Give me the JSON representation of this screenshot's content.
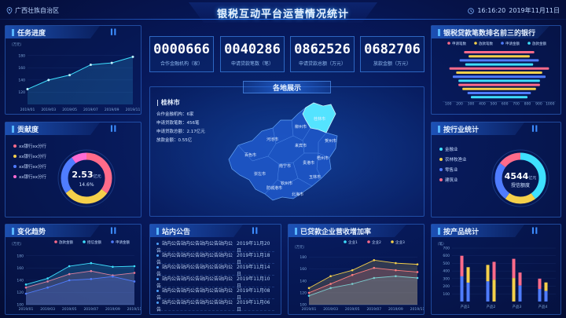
{
  "header": {
    "title": "银税互动平台运营情况统计",
    "region": "广西壮族自治区",
    "time": "16:16:20",
    "date": "2019年11月11日"
  },
  "colors": {
    "accent": "#2f7cff",
    "cyan": "#3ee0ff",
    "pink": "#ff6b8a",
    "yellow": "#f5d04a",
    "blue": "#4f7cff",
    "green": "#5fe0a0"
  },
  "counters": [
    {
      "value": "0000666",
      "label": "合作金融机构（家）"
    },
    {
      "value": "0040286",
      "label": "申请贷款笔数（笔）"
    },
    {
      "value": "0862526",
      "label": "申请贷款总额（万元）"
    },
    {
      "value": "0682706",
      "label": "放款金额（万元）"
    }
  ],
  "panels": {
    "progress": "任务进度",
    "contribution": "贡献度",
    "trend": "变化趋势",
    "map": "各地展示",
    "notice": "站内公告",
    "growth": "已贷款企业营收增加率",
    "top3": "银税贷款笔数排名前三的银行",
    "industry": "按行业统计",
    "product": "按产品统计"
  },
  "progress_chart": {
    "unit": "（万元）",
    "y_ticks": [
      "180",
      "160",
      "140",
      "120"
    ],
    "x_ticks": [
      "2019/01",
      "2019/03",
      "2019/05",
      "2019/07",
      "2019/09",
      "2019/11"
    ]
  },
  "contribution": {
    "legend": [
      "xx银行xx分行",
      "xx银行xx分行",
      "xx银行xx分行",
      "xx银行xx分行"
    ],
    "value": "2.53",
    "unit": "亿元",
    "percent": "14.6%"
  },
  "trend_chart": {
    "unit": "（万元）",
    "legend": [
      "放款金额",
      "授信金额",
      "申请金额"
    ],
    "y_ticks": [
      "180",
      "160",
      "140",
      "120",
      "100"
    ],
    "x_ticks": [
      "2019/01",
      "2019/03",
      "2019/05",
      "2019/07",
      "2019/09",
      "2019/11"
    ]
  },
  "map": {
    "selected_city": "桂林市",
    "info": [
      "合作金融机构：6家",
      "申请贷款笔数：456笔",
      "申请贷款总额：2.17亿元",
      "放款金额：0.55亿"
    ],
    "cities": [
      "桂林市",
      "柳州市",
      "河池市",
      "来宾市",
      "百色市",
      "贺州市",
      "梧州市",
      "南宁市",
      "贵港市",
      "崇左市",
      "玉林市",
      "防城港市",
      "钦州市",
      "北海市"
    ]
  },
  "notices": [
    {
      "text": "站内公告站内公告站内公告站内公告",
      "date": "2019年11月20日"
    },
    {
      "text": "站内公告站内公告站内公告站内公告",
      "date": "2019年11月18日"
    },
    {
      "text": "站内公告站内公告站内公告站内公告",
      "date": "2019年11月14日"
    },
    {
      "text": "站内公告站内公告站内公告站内公告",
      "date": "2019年11月10日"
    },
    {
      "text": "站内公告站内公告站内公告站内公告",
      "date": "2019年11月08日"
    },
    {
      "text": "站内公告站内公告站内公告站内公告",
      "date": "2019年11月06日"
    }
  ],
  "growth_chart": {
    "unit": "（万元）",
    "legend": [
      "企业1",
      "企业2",
      "企业3"
    ],
    "y_ticks": [
      "180",
      "160",
      "140",
      "120",
      "100"
    ],
    "x_ticks": [
      "2019/01",
      "2019/03",
      "2019/05",
      "2019/07",
      "2019/09",
      "2019/11"
    ]
  },
  "top3_chart": {
    "legend": [
      "申请笔数",
      "放款笔数",
      "申请金额",
      "放款金额"
    ],
    "x_ticks": [
      "100",
      "200",
      "300",
      "400",
      "500",
      "600",
      "700",
      "800",
      "900",
      "1000"
    ]
  },
  "industry": {
    "legend": [
      "金融业",
      "农林牧渔业",
      "零售业",
      "建筑业"
    ],
    "value": "4544",
    "unit": "亿元",
    "label": "授信额度"
  },
  "product_chart": {
    "unit": "（笔）",
    "y_ticks": [
      "700",
      "600",
      "500",
      "400",
      "300",
      "200",
      "100"
    ],
    "x_ticks": [
      "产品1",
      "产品2",
      "产品3",
      "产品4"
    ]
  },
  "chart_data": [
    {
      "type": "line",
      "title": "任务进度",
      "x": [
        "2019/01",
        "2019/03",
        "2019/05",
        "2019/07",
        "2019/09",
        "2019/11"
      ],
      "values": [
        125,
        140,
        148,
        165,
        168,
        178
      ],
      "ylabel": "（万元）",
      "ylim": [
        100,
        190
      ]
    },
    {
      "type": "pie",
      "title": "贡献度",
      "labels": [
        "xx银行xx分行",
        "xx银行xx分行",
        "xx银行xx分行",
        "xx银行xx分行"
      ],
      "values": [
        35,
        30,
        25,
        10
      ]
    },
    {
      "type": "line",
      "title": "变化趋势",
      "x": [
        "2019/01",
        "2019/03",
        "2019/05",
        "2019/07",
        "2019/09",
        "2019/11"
      ],
      "series": [
        {
          "name": "放款金额",
          "values": [
            128,
            138,
            150,
            155,
            148,
            152
          ]
        },
        {
          "name": "授信金额",
          "values": [
            133,
            143,
            163,
            168,
            162,
            163
          ]
        },
        {
          "name": "申请金额",
          "values": [
            118,
            128,
            140,
            142,
            146,
            138
          ]
        }
      ],
      "ylim": [
        100,
        190
      ]
    },
    {
      "type": "line",
      "title": "已贷款企业营收增加率",
      "x": [
        "2019/01",
        "2019/03",
        "2019/05",
        "2019/07",
        "2019/09",
        "2019/11"
      ],
      "series": [
        {
          "name": "企业1",
          "values": [
            115,
            128,
            135,
            145,
            148,
            145
          ]
        },
        {
          "name": "企业2",
          "values": [
            120,
            135,
            150,
            162,
            158,
            155
          ]
        },
        {
          "name": "企业3",
          "values": [
            128,
            148,
            158,
            175,
            170,
            168
          ]
        }
      ],
      "ylim": [
        100,
        190
      ]
    },
    {
      "type": "bar",
      "title": "银税贷款笔数排名前三的银行",
      "series": [
        {
          "name": "申请笔数",
          "values": [
            620,
            880,
            720
          ]
        },
        {
          "name": "放款笔数",
          "values": [
            540,
            760,
            650
          ]
        },
        {
          "name": "申请金额",
          "values": [
            700,
            820,
            560
          ]
        },
        {
          "name": "放款金额",
          "values": [
            600,
            720,
            500
          ]
        }
      ]
    },
    {
      "type": "pie",
      "title": "按行业统计",
      "labels": [
        "金融业",
        "农林牧渔业",
        "零售业",
        "建筑业"
      ],
      "values": [
        40,
        20,
        25,
        15
      ]
    },
    {
      "type": "bar",
      "title": "按产品统计",
      "categories": [
        "产品1",
        "产品2",
        "产品3",
        "产品4"
      ],
      "series": [
        {
          "name": "a",
          "values": [
            600,
            480,
            560,
            300
          ]
        },
        {
          "name": "b",
          "values": [
            450,
            520,
            380,
            250
          ]
        }
      ],
      "ylim": [
        0,
        700
      ]
    }
  ]
}
